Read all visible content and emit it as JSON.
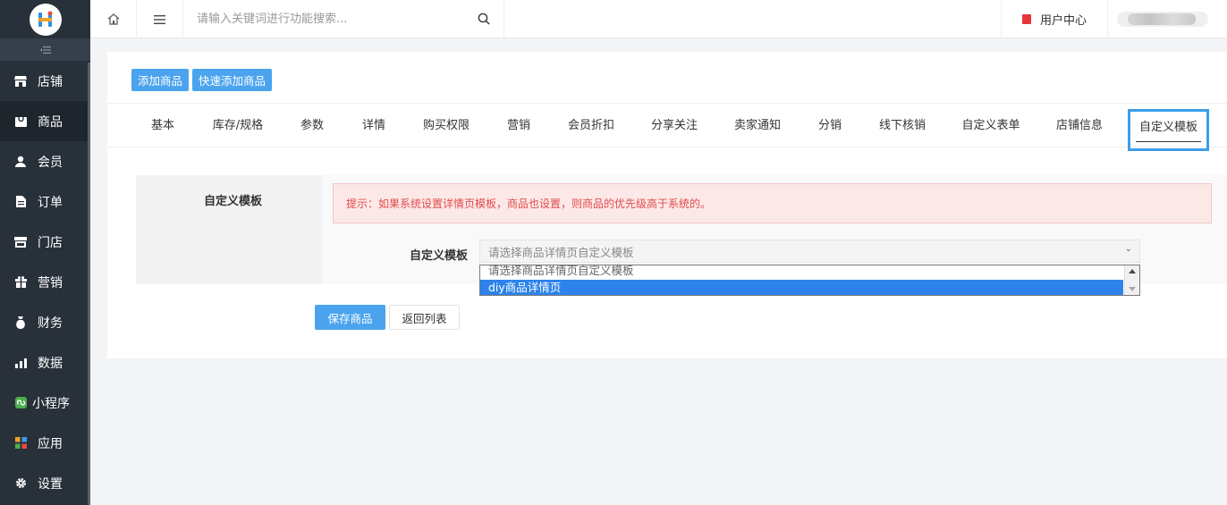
{
  "sidebar": {
    "collapse_icon": "collapse-icon",
    "items": [
      {
        "label": "店铺",
        "icon": "store-icon"
      },
      {
        "label": "商品",
        "icon": "goods-icon"
      },
      {
        "label": "会员",
        "icon": "user-icon"
      },
      {
        "label": "订单",
        "icon": "order-icon"
      },
      {
        "label": "门店",
        "icon": "shop-icon"
      },
      {
        "label": "营销",
        "icon": "gift-icon"
      },
      {
        "label": "财务",
        "icon": "money-bag-icon"
      },
      {
        "label": "数据",
        "icon": "chart-icon"
      },
      {
        "label": "小程序",
        "icon": "mini-program-icon"
      },
      {
        "label": "应用",
        "icon": "apps-icon"
      },
      {
        "label": "设置",
        "icon": "gear-icon"
      }
    ],
    "active_index": 1
  },
  "header": {
    "search_placeholder": "请输入关键词进行功能搜索...",
    "user_center_label": "用户中心"
  },
  "toolbar": {
    "add_goods_label": "添加商品",
    "quick_add_label": "快速添加商品"
  },
  "tabs": [
    {
      "label": "基本"
    },
    {
      "label": "库存/规格"
    },
    {
      "label": "参数"
    },
    {
      "label": "详情"
    },
    {
      "label": "购买权限"
    },
    {
      "label": "营销"
    },
    {
      "label": "会员折扣"
    },
    {
      "label": "分享关注"
    },
    {
      "label": "卖家通知"
    },
    {
      "label": "分销"
    },
    {
      "label": "线下核销"
    },
    {
      "label": "自定义表单"
    },
    {
      "label": "店铺信息"
    },
    {
      "label": "自定义模板"
    }
  ],
  "active_tab": "自定义模板",
  "form": {
    "section_label": "自定义模板",
    "tip": "提示：如果系统设置详情页模板，商品也设置，则商品的优先级高于系统的。",
    "field_label": "自定义模板",
    "select_value": "请选择商品详情页自定义模板",
    "options": [
      "请选择商品详情页自定义模板",
      "diy商品详情页"
    ],
    "highlighted_option": "diy商品详情页"
  },
  "actions": {
    "save_label": "保存商品",
    "back_label": "返回列表"
  },
  "colors": {
    "sidebar_bg": "#28303a",
    "accent": "#4ba3ee",
    "tip_text": "#e04b4b",
    "tip_bg": "#fde8e8",
    "option_highlight": "#2d83ea"
  }
}
